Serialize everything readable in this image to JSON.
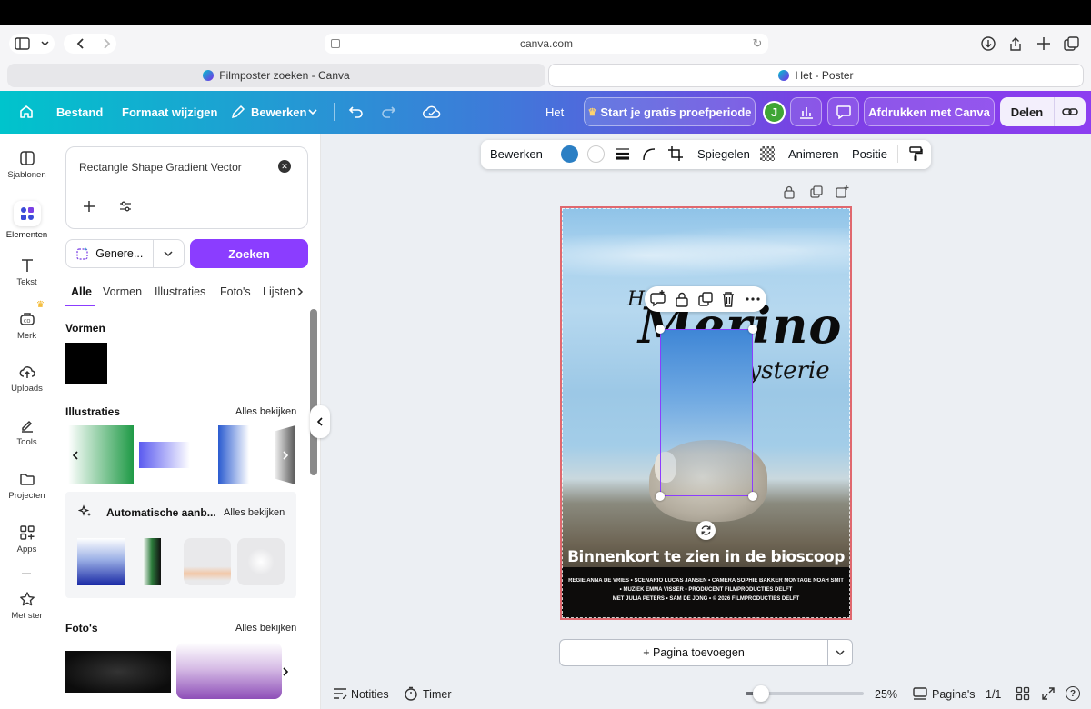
{
  "browser": {
    "url": "canva.com",
    "tabs": [
      {
        "title": "Filmposter zoeken - Canva"
      },
      {
        "title": "Het - Poster"
      }
    ]
  },
  "toolbar": {
    "bestand": "Bestand",
    "formaat": "Formaat wijzigen",
    "bewerken": "Bewerken",
    "doc_title": "Het",
    "trial": "Start je gratis proefperiode",
    "avatar": "J",
    "print": "Afdrukken met Canva",
    "share": "Delen"
  },
  "rail": {
    "items": [
      {
        "label": "Sjablonen",
        "icon": "template-icon"
      },
      {
        "label": "Elementen",
        "icon": "elements-icon"
      },
      {
        "label": "Tekst",
        "icon": "text-icon"
      },
      {
        "label": "Merk",
        "icon": "brand-icon"
      },
      {
        "label": "Uploads",
        "icon": "upload-icon"
      },
      {
        "label": "Tools",
        "icon": "tools-icon"
      },
      {
        "label": "Projecten",
        "icon": "folder-icon"
      },
      {
        "label": "Apps",
        "icon": "apps-icon"
      },
      {
        "label": "Met ster",
        "icon": "star-icon"
      }
    ]
  },
  "panel": {
    "search_value": "Rectangle Shape Gradient Vector",
    "generate_label": "Genere...",
    "search_button": "Zoeken",
    "filters": [
      "Alle",
      "Vormen",
      "Illustraties",
      "Foto's",
      "Lijsten"
    ],
    "sections": {
      "shapes": "Vormen",
      "illustrations": "Illustraties",
      "auto": "Automatische aanb...",
      "photos": "Foto's"
    },
    "see_all": "Alles bekijken"
  },
  "context_toolbar": {
    "edit": "Bewerken",
    "mirror": "Spiegelen",
    "animate": "Animeren",
    "position": "Positie",
    "color1": "#2b7fc4",
    "color2": "#ffffff"
  },
  "poster": {
    "title_small_left": "Het",
    "title_main": "Merino",
    "title_sub": "Mysterie",
    "tagline": "Binnenkort te zien in de bioscoop",
    "credits_1": "REGIE ANNA DE VRIES • SCENARIO LUCAS JANSEN • CAMERA SOPHIE BAKKER MONTAGE NOAH SMIT",
    "credits_2": "• MUZIEK EMMA VISSER • PRODUCENT FILMPRODUCTIES DELFT",
    "credits_3": "MET JULIA PETERS • SAM DE JONG • © 2026 FILMPRODUCTIES DELFT"
  },
  "canvas": {
    "add_page": "+ Pagina toevoegen"
  },
  "bottom": {
    "notes": "Notities",
    "timer": "Timer",
    "zoom_value": 25,
    "zoom": "25%",
    "pages": "Pagina's",
    "page_count": "1/1"
  }
}
